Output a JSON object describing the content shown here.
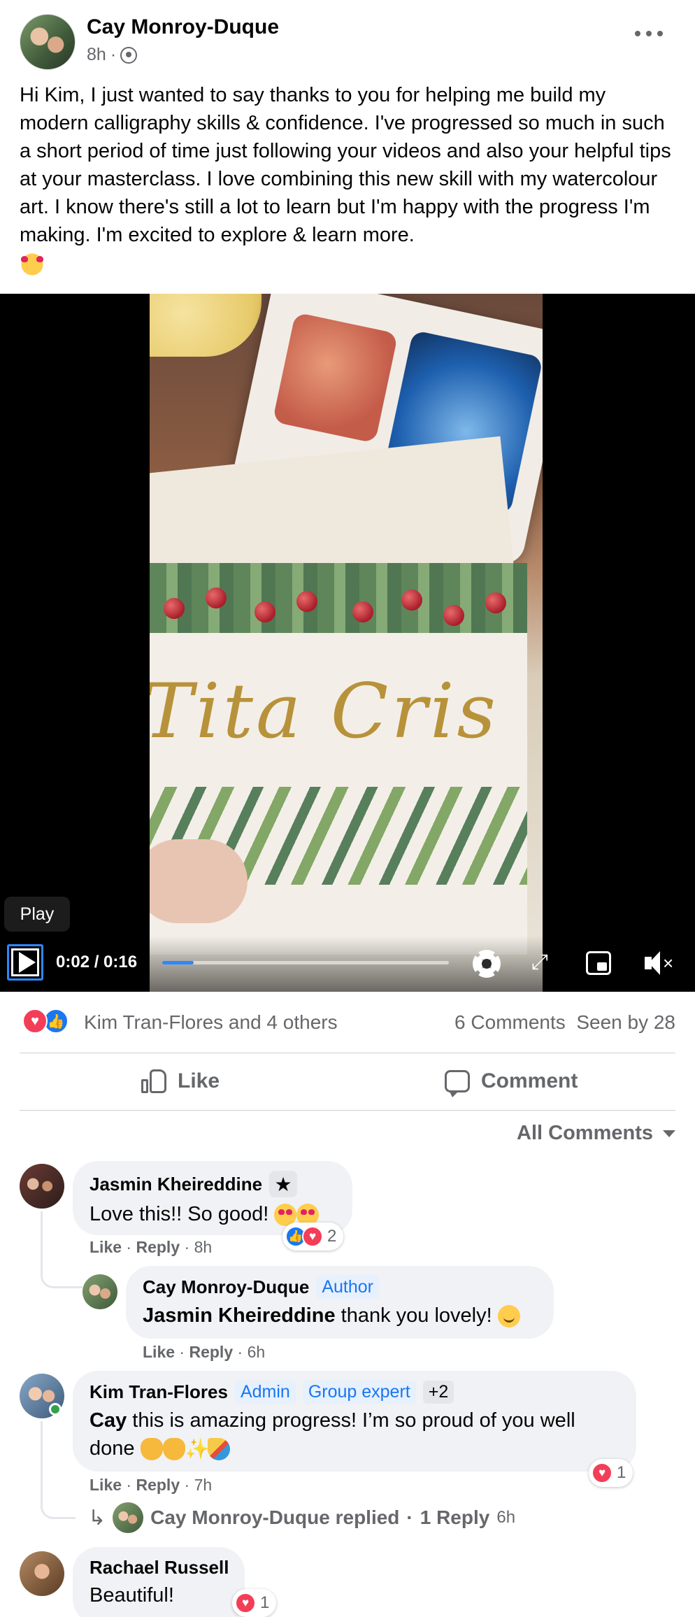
{
  "post": {
    "author": "Cay Monroy-Duque",
    "time": "8h",
    "meta_sep": "·",
    "audience_icon": "group-icon",
    "text": "Hi Kim, I just wanted to say thanks to you for helping me build my modern calligraphy skills & confidence. I've progressed so much in such a short period of time just following your videos and also your helpful tips at your masterclass. I love combining this new skill with my watercolour art. I know there's still a lot to learn but I'm happy with the progress I'm making. I'm excited to explore & learn more.",
    "emoji": "smiling-face-with-hearts"
  },
  "video": {
    "tooltip": "Play",
    "current_time": "0:02",
    "duration": "/ 0:16",
    "progress_fraction": 0.11,
    "card_script": "Tita Cris"
  },
  "reactions": {
    "names": "Kim Tran-Flores and 4 others",
    "comments_count": "6 Comments",
    "seen_by": "Seen by 28"
  },
  "actions": {
    "like_label": "Like",
    "comment_label": "Comment"
  },
  "filter": {
    "label": "All Comments"
  },
  "comments": [
    {
      "name": "Jasmin Kheireddine",
      "text": "Love this!! So good!",
      "like": "Like",
      "reply": "Reply",
      "time": "8h",
      "reaction_count": "2"
    },
    {
      "name": "Cay Monroy-Duque",
      "badge": "Author",
      "mention": "Jasmin Kheireddine",
      "text": " thank you lovely!",
      "like": "Like",
      "reply": "Reply",
      "time": "6h"
    },
    {
      "name": "Kim Tran-Flores",
      "badges": [
        "Admin",
        "Group expert",
        "+2"
      ],
      "mention": "Cay",
      "text": " this is amazing progress! I’m so proud of you well done",
      "like": "Like",
      "reply": "Reply",
      "time": "7h",
      "reaction_count": "1",
      "replied_by": "Cay Monroy-Duque replied",
      "reply_count": "1 Reply",
      "reply_time": "6h"
    },
    {
      "name": "Rachael Russell",
      "text": "Beautiful!",
      "reaction_count": "1"
    }
  ],
  "colors": {
    "accent": "#1877f2",
    "heart": "#f33e58",
    "muted_text": "#65676b",
    "bubble_bg": "#f0f2f5"
  }
}
